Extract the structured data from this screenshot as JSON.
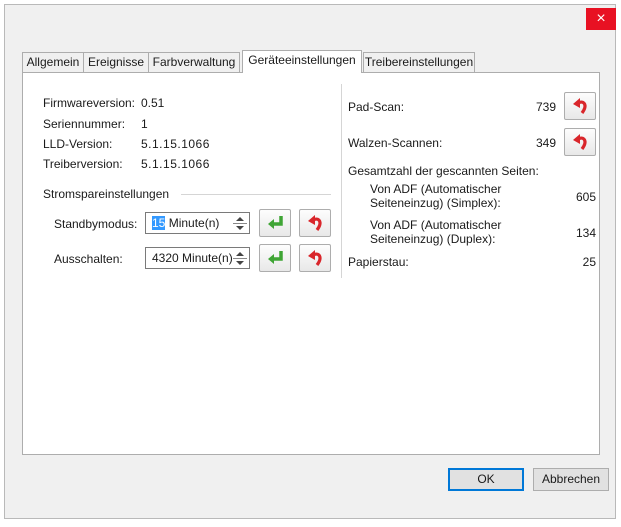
{
  "window": {
    "close_symbol": "×"
  },
  "tabs": [
    "Allgemein",
    "Ereignisse",
    "Farbverwaltung",
    "Geräteeinstellungen",
    "Treibereinstellungen"
  ],
  "active_tab": "Geräteeinstellungen",
  "device_info": {
    "firmware_label": "Firmwareversion:",
    "firmware_value": "0.51",
    "serial_label": "Seriennummer:",
    "serial_value": "1",
    "lld_label": "LLD-Version:",
    "lld_value": "5.1.15.1066",
    "driver_label": "Treiberversion:",
    "driver_value": "5.1.15.1066"
  },
  "power": {
    "group_title": "Stromspareinstellungen",
    "standby_label": "Standbymodus:",
    "standby_value_selected": "15",
    "standby_value_rest": " Minute(n)",
    "off_label": "Ausschalten:",
    "off_value": "4320 Minute(n)"
  },
  "counters": {
    "pad_label": "Pad-Scan:",
    "pad_value": "739",
    "roller_label": "Walzen-Scannen:",
    "roller_value": "349",
    "total_label": "Gesamtzahl der gescannten Seiten:",
    "simplex_label_line1": "Von ADF (Automatischer",
    "simplex_label_line2": "Seiteneinzug) (Simplex):",
    "simplex_value": "605",
    "duplex_label_line1": "Von ADF (Automatischer",
    "duplex_label_line2": "Seiteneinzug) (Duplex):",
    "duplex_value": "134",
    "jam_label": "Papierstau:",
    "jam_value": "25"
  },
  "buttons": {
    "ok": "OK",
    "cancel": "Abbrechen"
  },
  "colors": {
    "close": "#e81123",
    "apply_arrow": "#3fa535",
    "reset_arrow": "#d9262b"
  }
}
